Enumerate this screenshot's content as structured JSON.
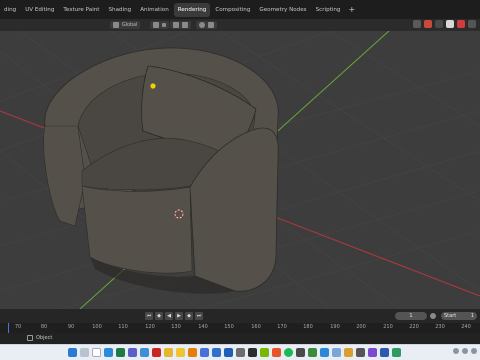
{
  "workspace_tabs": [
    {
      "label": "ding",
      "active": false
    },
    {
      "label": "UV Editing",
      "active": false
    },
    {
      "label": "Texture Paint",
      "active": false
    },
    {
      "label": "Shading",
      "active": false
    },
    {
      "label": "Animation",
      "active": false
    },
    {
      "label": "Rendering",
      "active": true
    },
    {
      "label": "Compositing",
      "active": false
    },
    {
      "label": "Geometry Nodes",
      "active": false
    },
    {
      "label": "Scripting",
      "active": false
    },
    {
      "label": "+",
      "active": false
    }
  ],
  "viewport_header": {
    "orientation": "Global",
    "snap": "",
    "proportional": ""
  },
  "colors": {
    "x_axis": "#b5383d",
    "y_axis": "#6aa53a",
    "fabric": "#57524a",
    "fabric_dark": "#3a3632",
    "light_dot": "#f5d000",
    "accent_blue": "#3f7ad8"
  },
  "timeline": {
    "current_frame": "1",
    "start_label": "Start",
    "start_value": "1",
    "ruler_ticks": [
      "70",
      "80",
      "90",
      "100",
      "110",
      "120",
      "130",
      "140",
      "150",
      "160",
      "170",
      "180",
      "190",
      "200",
      "210",
      "220",
      "230",
      "240"
    ]
  },
  "status_bar": {
    "mode_label": "Object"
  },
  "taskbar_icons": [
    "start-icon",
    "search-icon",
    "widgets-icon",
    "edge-icon",
    "excel-icon",
    "teams-icon",
    "photos-icon",
    "acrobat-icon",
    "chrome-icon",
    "files-icon",
    "blender-icon",
    "store-icon",
    "mail-icon",
    "outlook-icon",
    "settings-icon",
    "terminal-icon",
    "nvidia-icon",
    "media-icon",
    "spotify-icon",
    "calculator-icon",
    "game-icon",
    "vscode-icon",
    "notepad-icon",
    "paint-icon",
    "camera-icon",
    "clipchamp-icon",
    "word-icon",
    "maps-icon"
  ]
}
